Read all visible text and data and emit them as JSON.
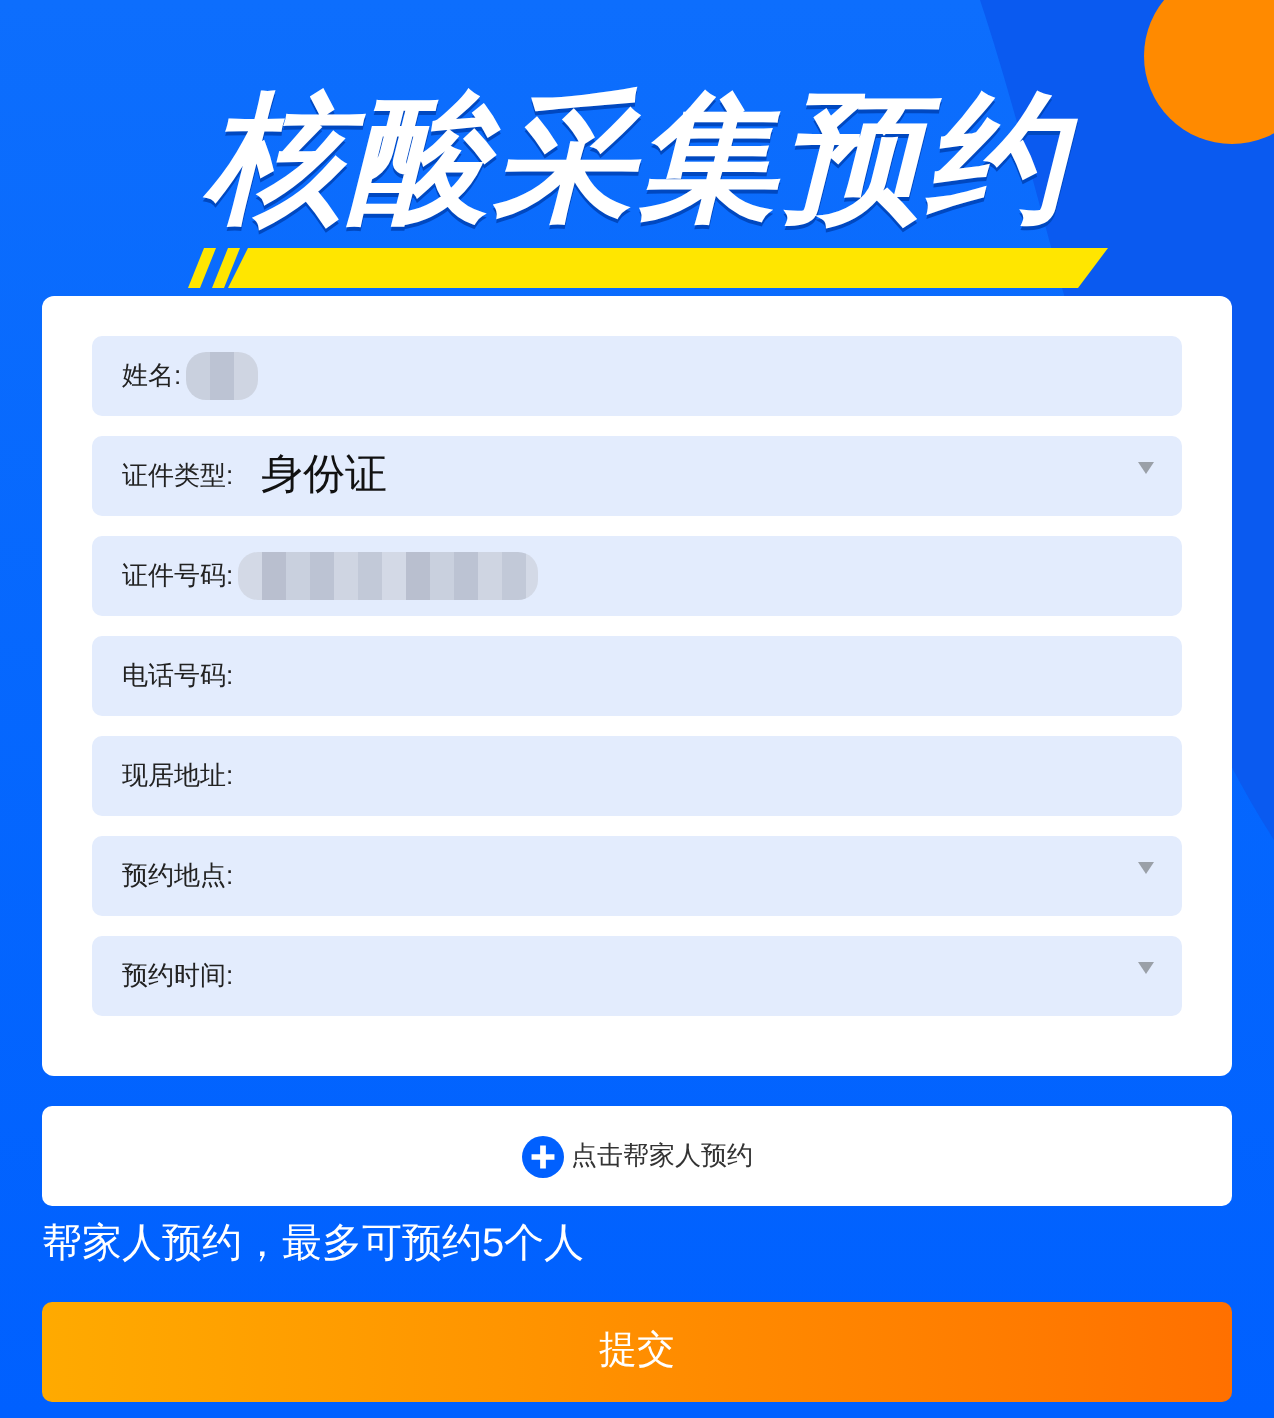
{
  "title": "核酸采集预约",
  "fields": [
    {
      "label": "姓名:",
      "kind": "text",
      "redacted": true
    },
    {
      "label": "证件类型:",
      "kind": "select",
      "value": "身份证"
    },
    {
      "label": "证件号码:",
      "kind": "text",
      "redacted": true
    },
    {
      "label": "电话号码:",
      "kind": "text"
    },
    {
      "label": "现居地址:",
      "kind": "text"
    },
    {
      "label": "预约地点:",
      "kind": "select"
    },
    {
      "label": "预约时间:",
      "kind": "select"
    }
  ],
  "add_family_button": {
    "label": "点击帮家人预约"
  },
  "note": "帮家人预约，最多可预约5个人",
  "submit_button": {
    "label": "提交"
  }
}
